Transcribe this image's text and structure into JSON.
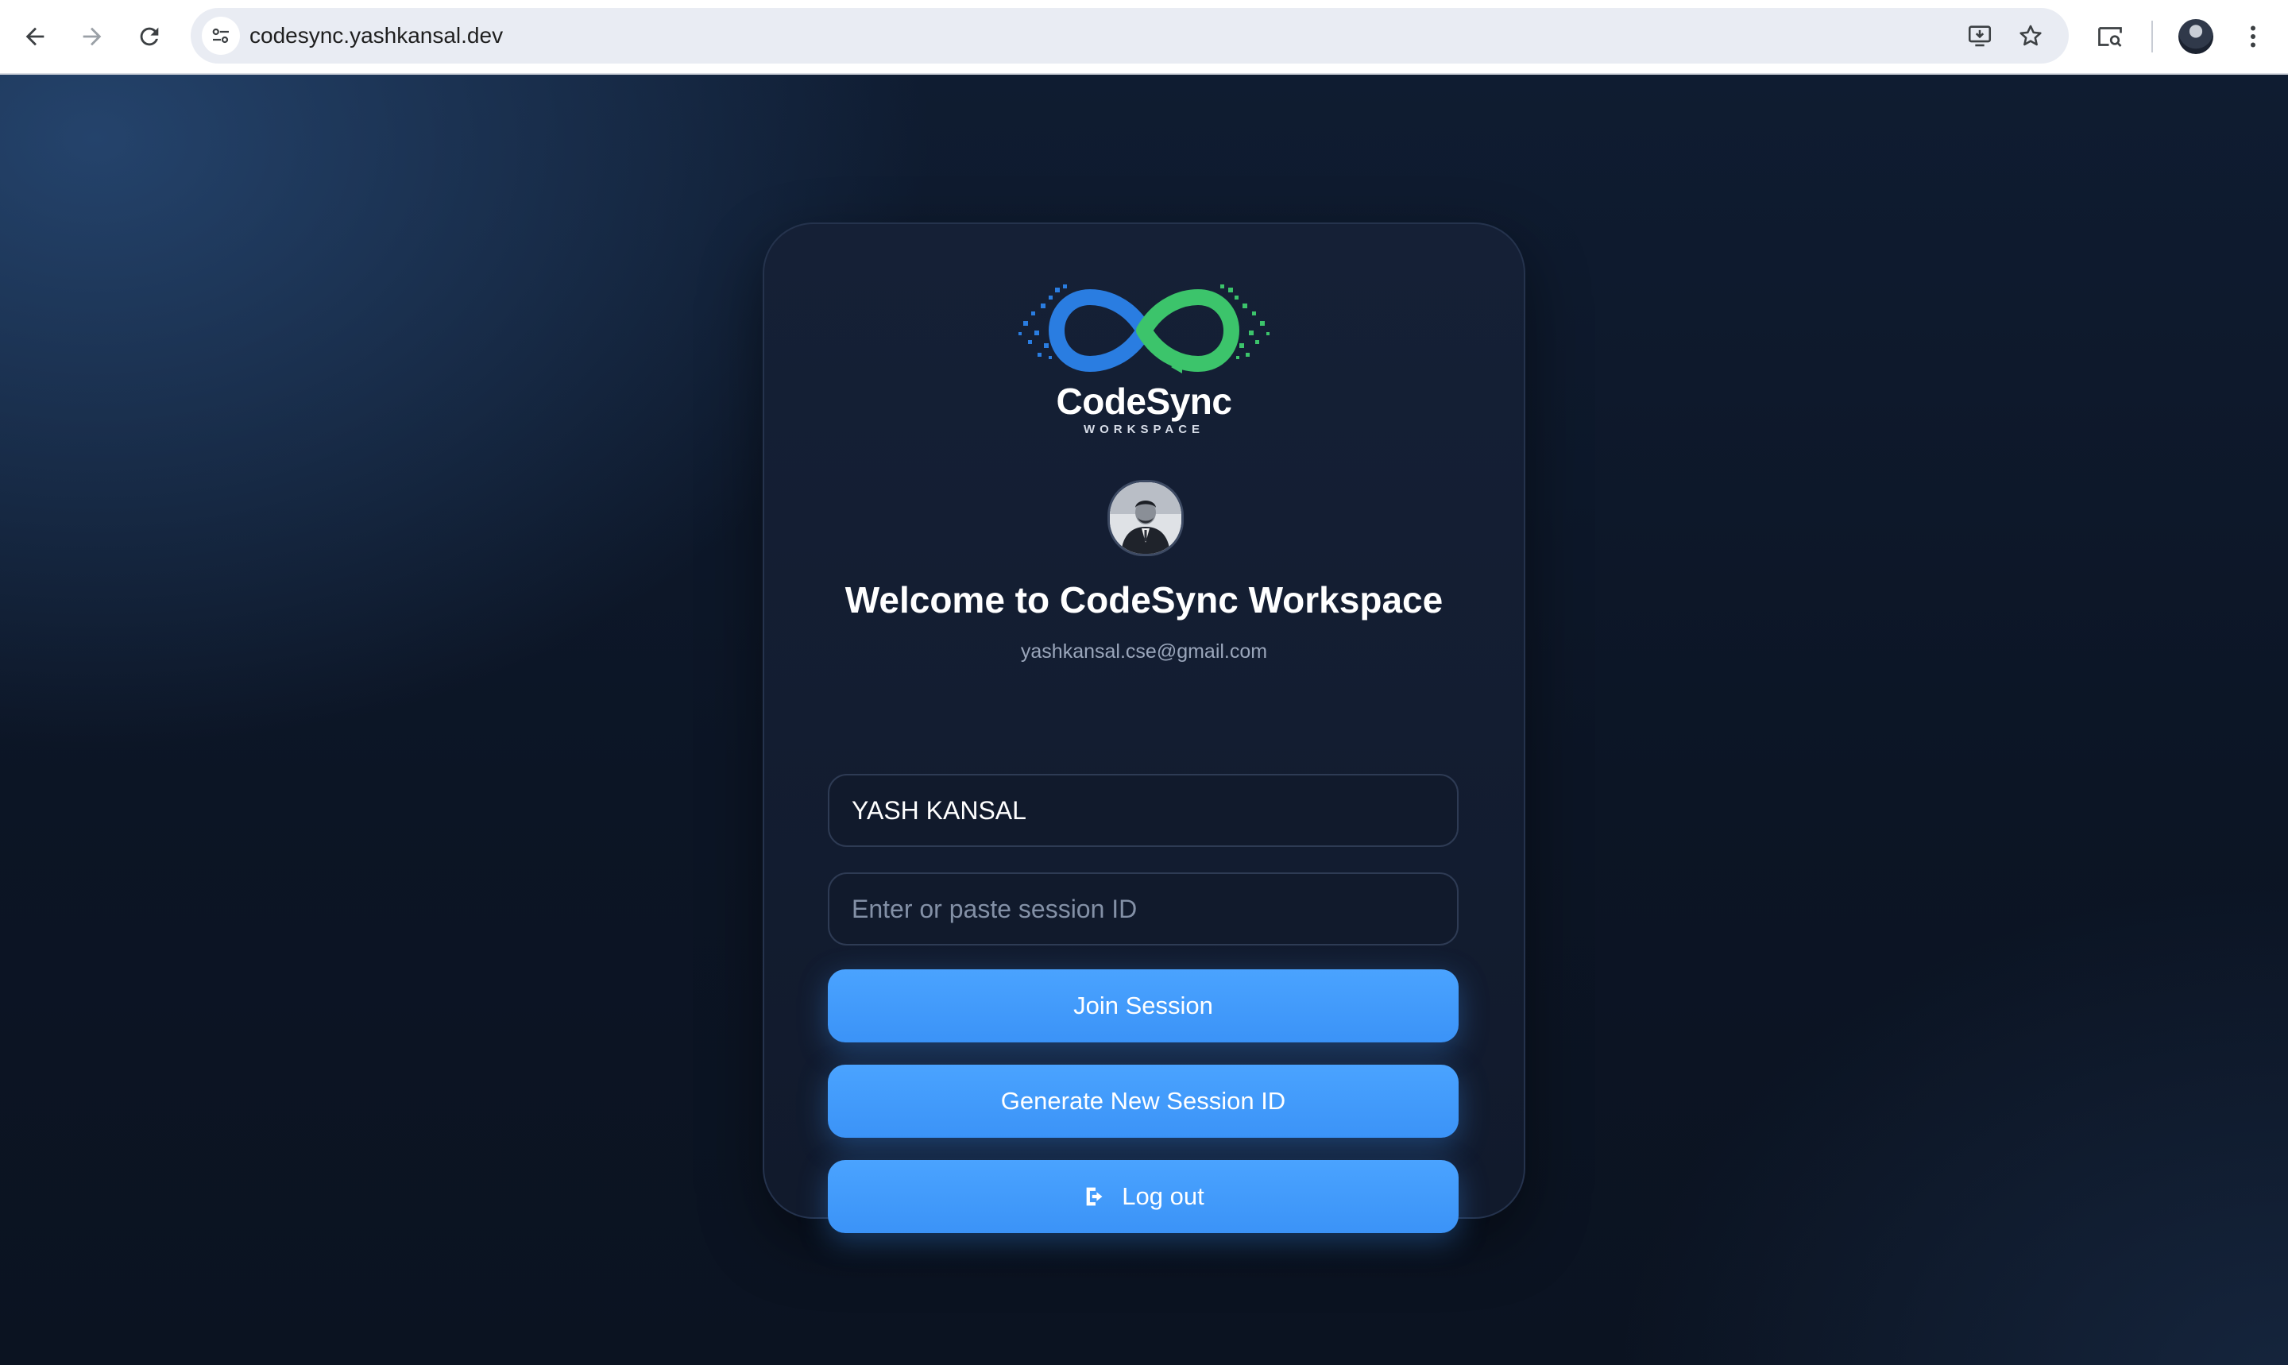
{
  "browser": {
    "url": "codesync.yashkansal.dev"
  },
  "brand": {
    "name": "CodeSync",
    "tagline": "WORKSPACE",
    "colors": {
      "blue": "#2a7de1",
      "green": "#3cc46b",
      "accent": "#4aa3ff"
    }
  },
  "card": {
    "welcome": "Welcome to CodeSync Workspace",
    "email": "yashkansal.cse@gmail.com",
    "name_field": {
      "value": "YASH KANSAL"
    },
    "session_field": {
      "value": "",
      "placeholder": "Enter or paste session ID"
    },
    "buttons": {
      "join": "Join Session",
      "generate": "Generate New Session ID",
      "logout": "Log out"
    }
  },
  "icons": {
    "back": "back-arrow-icon",
    "forward": "forward-arrow-icon",
    "reload": "reload-icon",
    "site_settings": "tune-icon",
    "install": "install-app-icon",
    "bookmark": "star-icon",
    "lens": "search-tab-icon",
    "menu": "kebab-menu-icon",
    "logout": "logout-icon"
  }
}
